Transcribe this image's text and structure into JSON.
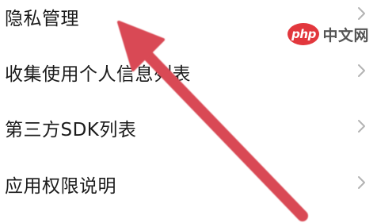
{
  "menu": {
    "items": [
      {
        "label": "隐私管理"
      },
      {
        "label": "收集使用个人信息列表"
      },
      {
        "label": "第三方SDK列表"
      },
      {
        "label": "应用权限说明"
      }
    ]
  },
  "watermark": {
    "logo_text": "php",
    "text": "中文网"
  },
  "annotation": {
    "arrow_color": "#d94a55",
    "icon": "arrow-icon"
  }
}
